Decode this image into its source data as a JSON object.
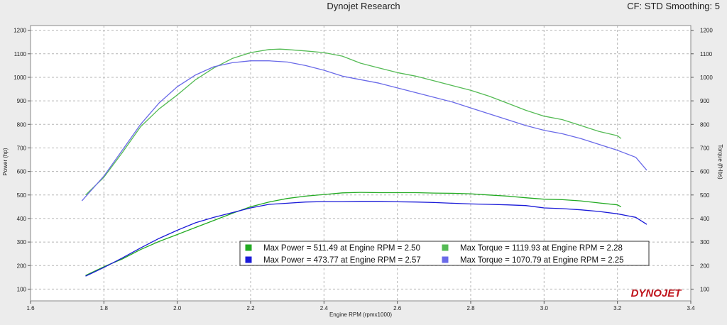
{
  "header": {
    "title": "Dynojet Research",
    "info": "CF: STD Smoothing: 5"
  },
  "brand": {
    "logo_text": "DYNOJET",
    "logo_color": "#c0141c"
  },
  "chart_data": {
    "type": "line",
    "xlabel": "Engine RPM (rpmx1000)",
    "ylabel_left": "Power (hp)",
    "ylabel_right": "Torque (ft-lbs)",
    "xlim": [
      1.6,
      3.4
    ],
    "ylim": [
      50,
      1220
    ],
    "x_ticks": [
      1.6,
      1.8,
      2.0,
      2.2,
      2.4,
      2.6,
      2.8,
      3.0,
      3.2,
      3.4
    ],
    "y_ticks": [
      100,
      200,
      300,
      400,
      500,
      600,
      700,
      800,
      900,
      1000,
      1100,
      1200
    ],
    "grid": true,
    "legend_position": "bottom-center",
    "series": [
      {
        "name": "Max Power",
        "color": "#22aa22",
        "x": [
          1.75,
          1.8,
          1.85,
          1.9,
          1.95,
          2.0,
          2.05,
          2.1,
          2.15,
          2.2,
          2.25,
          2.3,
          2.35,
          2.4,
          2.45,
          2.5,
          2.55,
          2.6,
          2.65,
          2.7,
          2.75,
          2.8,
          2.85,
          2.9,
          2.95,
          3.0,
          3.05,
          3.1,
          3.15,
          3.2,
          3.21
        ],
        "y": [
          158,
          195,
          228,
          268,
          302,
          332,
          362,
          392,
          422,
          450,
          470,
          485,
          495,
          502,
          509,
          511,
          510,
          510,
          510,
          508,
          507,
          505,
          500,
          495,
          488,
          482,
          480,
          475,
          466,
          458,
          450
        ]
      },
      {
        "name": "Max Power",
        "color": "#1a1ad8",
        "x": [
          1.75,
          1.8,
          1.85,
          1.9,
          1.95,
          2.0,
          2.05,
          2.1,
          2.15,
          2.2,
          2.25,
          2.3,
          2.35,
          2.4,
          2.45,
          2.5,
          2.55,
          2.6,
          2.65,
          2.7,
          2.75,
          2.8,
          2.85,
          2.9,
          2.95,
          3.0,
          3.05,
          3.1,
          3.15,
          3.2,
          3.25,
          3.28
        ],
        "y": [
          155,
          192,
          232,
          275,
          315,
          350,
          382,
          405,
          425,
          445,
          460,
          465,
          470,
          472,
          472,
          473,
          473,
          471,
          470,
          468,
          465,
          462,
          460,
          458,
          455,
          445,
          442,
          437,
          430,
          420,
          405,
          375
        ]
      },
      {
        "name": "Max Torque",
        "color": "#55bb55",
        "x": [
          1.75,
          1.8,
          1.85,
          1.9,
          1.95,
          2.0,
          2.05,
          2.1,
          2.15,
          2.2,
          2.25,
          2.28,
          2.3,
          2.35,
          2.4,
          2.45,
          2.5,
          2.55,
          2.6,
          2.65,
          2.7,
          2.75,
          2.8,
          2.85,
          2.9,
          2.95,
          3.0,
          3.05,
          3.1,
          3.15,
          3.2,
          3.21
        ],
        "y": [
          500,
          575,
          680,
          790,
          865,
          925,
          990,
          1040,
          1080,
          1105,
          1118,
          1120,
          1118,
          1112,
          1105,
          1090,
          1060,
          1040,
          1020,
          1005,
          985,
          965,
          945,
          920,
          890,
          860,
          835,
          820,
          795,
          770,
          752,
          740
        ]
      },
      {
        "name": "Max Torque",
        "color": "#6a6ae8",
        "x": [
          1.74,
          1.8,
          1.85,
          1.9,
          1.95,
          2.0,
          2.05,
          2.1,
          2.15,
          2.2,
          2.25,
          2.3,
          2.35,
          2.4,
          2.45,
          2.5,
          2.55,
          2.6,
          2.65,
          2.7,
          2.75,
          2.8,
          2.85,
          2.9,
          2.95,
          3.0,
          3.05,
          3.1,
          3.15,
          3.2,
          3.25,
          3.28
        ],
        "y": [
          475,
          580,
          690,
          800,
          890,
          960,
          1010,
          1045,
          1062,
          1070,
          1070,
          1065,
          1050,
          1030,
          1005,
          990,
          975,
          955,
          935,
          915,
          895,
          870,
          845,
          820,
          795,
          775,
          760,
          740,
          715,
          690,
          660,
          605
        ]
      }
    ],
    "legend": [
      {
        "swatch_color": "#22aa22",
        "text": "Max Power = 511.49 at Engine RPM = 2.50"
      },
      {
        "swatch_color": "#55bb55",
        "text": "Max Torque = 1119.93 at Engine RPM = 2.28"
      },
      {
        "swatch_color": "#1a1ad8",
        "text": "Max Power = 473.77 at Engine RPM = 2.57"
      },
      {
        "swatch_color": "#6a6ae8",
        "text": "Max Torque = 1070.79 at Engine RPM = 2.25"
      }
    ]
  }
}
